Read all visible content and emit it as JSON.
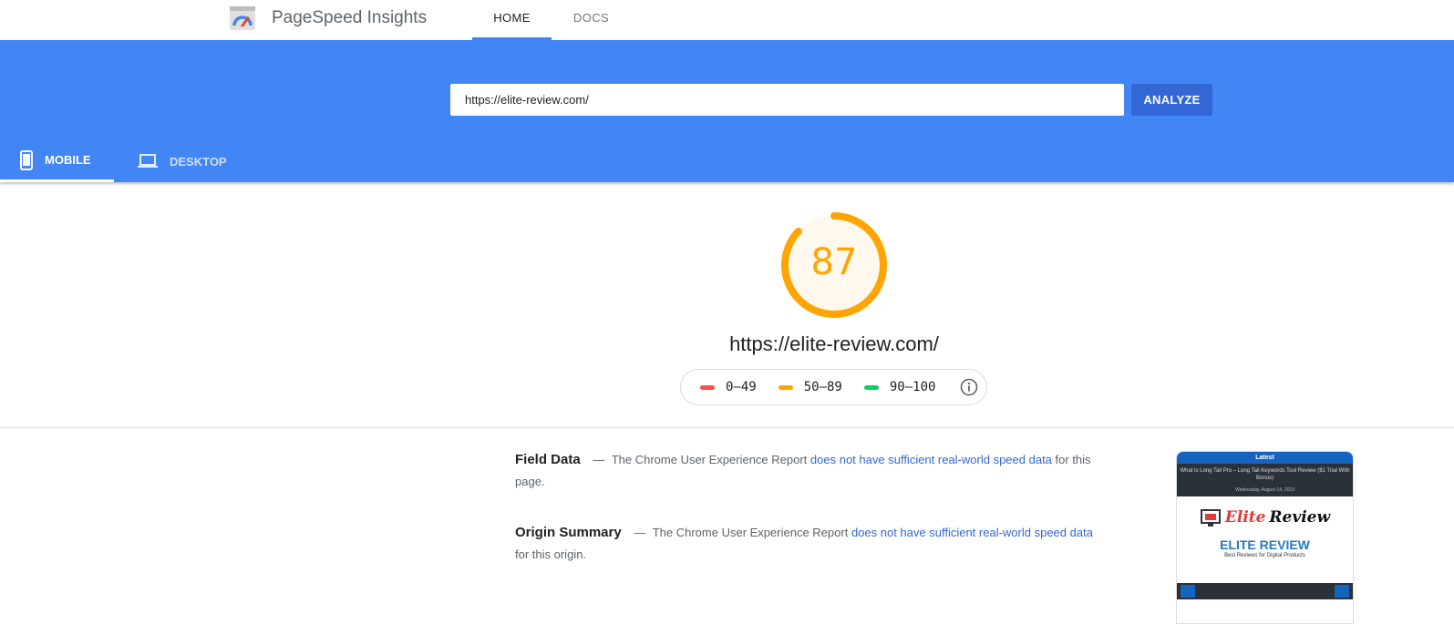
{
  "topnav": {
    "brand": "PageSpeed Insights",
    "tabs": [
      {
        "label": "HOME",
        "active": true
      },
      {
        "label": "DOCS",
        "active": false
      }
    ]
  },
  "hero": {
    "url_value": "https://elite-review.com/",
    "analyze_label": "ANALYZE",
    "device_tabs": [
      {
        "label": "MOBILE",
        "icon": "phone-icon",
        "active": true
      },
      {
        "label": "DESKTOP",
        "icon": "laptop-icon",
        "active": false
      }
    ]
  },
  "score": {
    "value": "87",
    "percent": 87,
    "color": "#ffa400",
    "url": "https://elite-review.com/"
  },
  "legend": [
    {
      "range": "0–49",
      "color": "#ff4e42"
    },
    {
      "range": "50–89",
      "color": "#ffa400"
    },
    {
      "range": "90–100",
      "color": "#0cce6b"
    }
  ],
  "field_data": {
    "heading": "Field Data",
    "dash": "—",
    "text_before": "The Chrome User Experience Report",
    "link": "does not have sufficient real-world speed data",
    "text_after": "for this page."
  },
  "origin_summary": {
    "heading": "Origin Summary",
    "dash": "—",
    "text_before": "The Chrome User Experience Report",
    "link": "does not have sufficient real-world speed data",
    "text_after": "for this origin."
  },
  "thumbnail": {
    "latest": "Latest",
    "headline": "What is Long Tail Pro – Long Tail Keywords Tool Review ($1 Trial With Bonus)",
    "date": "Wednesday, August 14, 2019",
    "logo_word1": "Elite",
    "logo_word2": "Review",
    "site_title": "ELITE REVIEW",
    "site_subtitle": "Best Reviews for Digital Products"
  }
}
